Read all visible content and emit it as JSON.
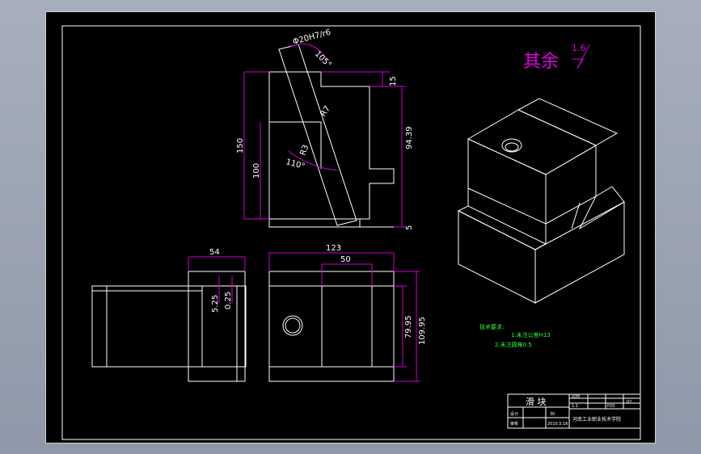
{
  "drawing": {
    "roughness_note": "其余",
    "roughness_value": "1.6",
    "dims": {
      "fit_dia": "Φ20H7/r6",
      "angle_105": "105°",
      "h15": "15",
      "r7": "R7",
      "h94": "94.39",
      "h150": "150",
      "r3": "R3",
      "angle_110": "110°",
      "h100": "100",
      "h5": "5",
      "w54": "54",
      "d525": "5.25",
      "d025": "0.25",
      "w123": "123",
      "w50": "50",
      "h7995": "79.95",
      "h10995": "109.95"
    },
    "tech_req": {
      "title": "技术要求:",
      "line1": "1.未注公差H13",
      "line2": "2.未注圆角0.5"
    },
    "title_block": {
      "part_name": "滑 块",
      "scale_label": "比例",
      "scale": "1:1",
      "material": "P20",
      "sheet": "共 张",
      "qty": "30",
      "designer": "设计",
      "checker": "审核",
      "date": "2010.5.16",
      "school": "河南工业职业技术学院",
      "page": "02"
    }
  },
  "colors": {
    "background": "#9aa2b1",
    "sheet": "#000000",
    "outline": "#ffffff",
    "dimension": "#d000d0",
    "annotation": "#30ff30",
    "roughness": "#e000e0"
  }
}
